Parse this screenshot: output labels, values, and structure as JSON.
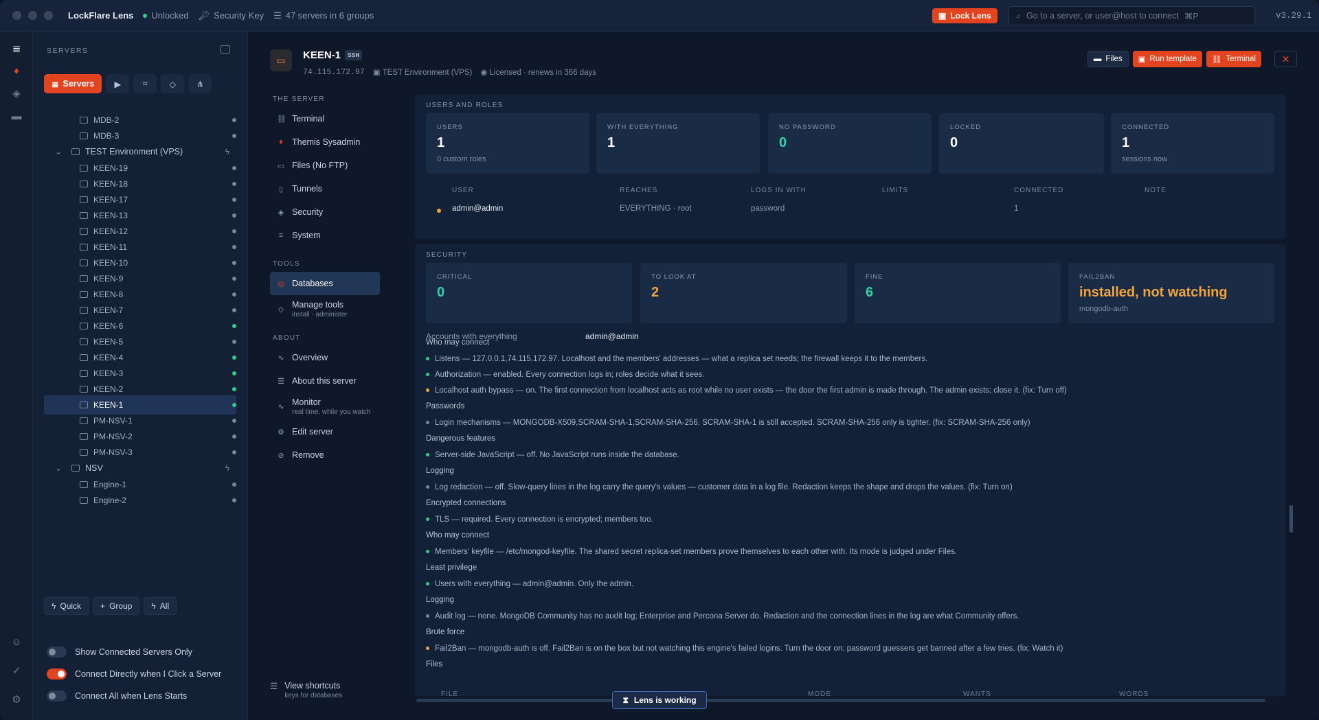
{
  "app": {
    "title": "LockFlare Lens",
    "status": "Unlocked",
    "security_key": "Security Key",
    "servers_summary": "47 servers in 6 groups",
    "lock_label": "Lock Lens",
    "search_placeholder": "Go to a server, or user@host to connect",
    "search_shortcut": "⌘P",
    "version": "v3.29.1"
  },
  "sidebar": {
    "header": "SERVERS",
    "servers_tab": "Servers",
    "rows": [
      {
        "label": "MDB-2",
        "type": "server",
        "status": "gray"
      },
      {
        "label": "MDB-3",
        "type": "server",
        "status": "gray"
      },
      {
        "label": "TEST Environment (VPS)",
        "type": "group"
      },
      {
        "label": "KEEN-19",
        "type": "server",
        "status": "gray"
      },
      {
        "label": "KEEN-18",
        "type": "server",
        "status": "gray"
      },
      {
        "label": "KEEN-17",
        "type": "server",
        "status": "gray"
      },
      {
        "label": "KEEN-13",
        "type": "server",
        "status": "gray"
      },
      {
        "label": "KEEN-12",
        "type": "server",
        "status": "gray"
      },
      {
        "label": "KEEN-11",
        "type": "server",
        "status": "gray"
      },
      {
        "label": "KEEN-10",
        "type": "server",
        "status": "gray"
      },
      {
        "label": "KEEN-9",
        "type": "server",
        "status": "gray"
      },
      {
        "label": "KEEN-8",
        "type": "server",
        "status": "gray"
      },
      {
        "label": "KEEN-7",
        "type": "server",
        "status": "gray"
      },
      {
        "label": "KEEN-6",
        "type": "server",
        "status": "green"
      },
      {
        "label": "KEEN-5",
        "type": "server",
        "status": "gray"
      },
      {
        "label": "KEEN-4",
        "type": "server",
        "status": "green"
      },
      {
        "label": "KEEN-3",
        "type": "server",
        "status": "green"
      },
      {
        "label": "KEEN-2",
        "type": "server",
        "status": "green"
      },
      {
        "label": "KEEN-1",
        "type": "server",
        "status": "green",
        "selected": true
      },
      {
        "label": "PM-NSV-1",
        "type": "server",
        "status": "gray"
      },
      {
        "label": "PM-NSV-2",
        "type": "server",
        "status": "gray"
      },
      {
        "label": "PM-NSV-3",
        "type": "server",
        "status": "gray"
      },
      {
        "label": "NSV",
        "type": "group"
      },
      {
        "label": "Engine-1",
        "type": "server",
        "status": "gray"
      },
      {
        "label": "Engine-2",
        "type": "server",
        "status": "gray"
      }
    ],
    "quick": "Quick",
    "group": "Group",
    "all": "All",
    "toggles": [
      {
        "label": "Show Connected Servers Only",
        "on": false
      },
      {
        "label": "Connect Directly when I Click a Server",
        "on": true
      },
      {
        "label": "Connect All when Lens Starts",
        "on": false
      }
    ]
  },
  "server": {
    "name": "KEEN-1",
    "proto": "SSH",
    "ip": "74.115.172.97",
    "env": "TEST Environment (VPS)",
    "license": "Licensed · renews in 366 days",
    "btn_files": "Files",
    "btn_template": "Run template",
    "btn_terminal": "Terminal"
  },
  "nav": {
    "h_server": "THE SERVER",
    "h_tools": "TOOLS",
    "h_about": "ABOUT",
    "terminal": "Terminal",
    "themis": "Themis Sysadmin",
    "files": "Files (No FTP)",
    "tunnels": "Tunnels",
    "security": "Security",
    "system": "System",
    "databases": "Databases",
    "manage": "Manage tools",
    "manage_sub": "install · administer",
    "overview": "Overview",
    "about": "About this server",
    "monitor": "Monitor",
    "monitor_sub": "real time, while you watch",
    "edit": "Edit server",
    "remove": "Remove",
    "shortcuts": "View shortcuts",
    "shortcuts_sub": "keys for databases"
  },
  "users": {
    "title": "USERS AND ROLES",
    "cards": [
      {
        "label": "USERS",
        "value": "1",
        "sub": "0 custom roles"
      },
      {
        "label": "WITH EVERYTHING",
        "value": "1",
        "sub": ""
      },
      {
        "label": "NO PASSWORD",
        "value": "0",
        "sub": ""
      },
      {
        "label": "LOCKED",
        "value": "0",
        "sub": ""
      },
      {
        "label": "CONNECTED",
        "value": "1",
        "sub": "sessions now"
      }
    ],
    "cols": [
      "USER",
      "REACHES",
      "LOGS IN WITH",
      "LIMITS",
      "CONNECTED",
      "NOTE"
    ],
    "row": {
      "user": "admin@admin",
      "reaches": "EVERYTHING · root",
      "logs": "password",
      "limits": "",
      "connected": "1",
      "note": ""
    }
  },
  "security": {
    "title": "SECURITY",
    "cards": [
      {
        "label": "CRITICAL",
        "value": "0",
        "sub": ""
      },
      {
        "label": "TO LOOK AT",
        "value": "2",
        "sub": ""
      },
      {
        "label": "FINE",
        "value": "6",
        "sub": ""
      },
      {
        "label": "FAIL2BAN",
        "value": "installed, not watching",
        "sub": "mongodb-auth"
      }
    ],
    "accounts_label": "Accounts with everything",
    "accounts_value": "admin@admin",
    "items": [
      {
        "kind": "cat",
        "text": "Who may connect"
      },
      {
        "kind": "line",
        "status": "green",
        "text": "Listens — 127.0.0.1,74.115.172.97. Localhost and the members' addresses — what a replica set needs; the firewall keeps it to the members."
      },
      {
        "kind": "line",
        "status": "green",
        "text": "Authorization — enabled. Every connection logs in; roles decide what it sees."
      },
      {
        "kind": "line",
        "status": "orange",
        "text": "Localhost auth bypass — on. The first connection from localhost acts as root while no user exists — the door the first admin is made through. The admin exists; close it. (fix: Turn off)"
      },
      {
        "kind": "cat",
        "text": "Passwords"
      },
      {
        "kind": "line",
        "status": "gray",
        "text": "Login mechanisms — MONGODB-X509,SCRAM-SHA-1,SCRAM-SHA-256. SCRAM-SHA-1 is still accepted. SCRAM-SHA-256 only is tighter. (fix: SCRAM-SHA-256 only)"
      },
      {
        "kind": "cat",
        "text": "Dangerous features"
      },
      {
        "kind": "line",
        "status": "green",
        "text": "Server-side JavaScript — off. No JavaScript runs inside the database."
      },
      {
        "kind": "cat",
        "text": "Logging"
      },
      {
        "kind": "line",
        "status": "gray",
        "text": "Log redaction — off. Slow-query lines in the log carry the query's values — customer data in a log file. Redaction keeps the shape and drops the values. (fix: Turn on)"
      },
      {
        "kind": "cat",
        "text": "Encrypted connections"
      },
      {
        "kind": "line",
        "status": "green",
        "text": "TLS — required. Every connection is encrypted; members too."
      },
      {
        "kind": "cat",
        "text": "Who may connect"
      },
      {
        "kind": "line",
        "status": "green",
        "text": "Members' keyfile — /etc/mongod-keyfile. The shared secret replica-set members prove themselves to each other with. Its mode is judged under Files."
      },
      {
        "kind": "cat",
        "text": "Least privilege"
      },
      {
        "kind": "line",
        "status": "green",
        "text": "Users with everything — admin@admin. Only the admin."
      },
      {
        "kind": "cat",
        "text": "Logging"
      },
      {
        "kind": "line",
        "status": "gray",
        "text": "Audit log — none. MongoDB Community has no audit log; Enterprise and Percona Server do. Redaction and the connection lines in the log are what Community offers."
      },
      {
        "kind": "cat",
        "text": "Brute force"
      },
      {
        "kind": "line",
        "status": "orange",
        "text": "Fail2Ban — mongodb-auth is off. Fail2Ban is on the box but not watching this engine's failed logins. Turn the door on: password guessers get banned after a few tries. (fix: Watch it)"
      },
      {
        "kind": "cat",
        "text": "Files"
      }
    ],
    "files_cols": [
      "FILE",
      "MODE",
      "WANTS",
      "WORDS"
    ]
  },
  "working": "Lens is working"
}
